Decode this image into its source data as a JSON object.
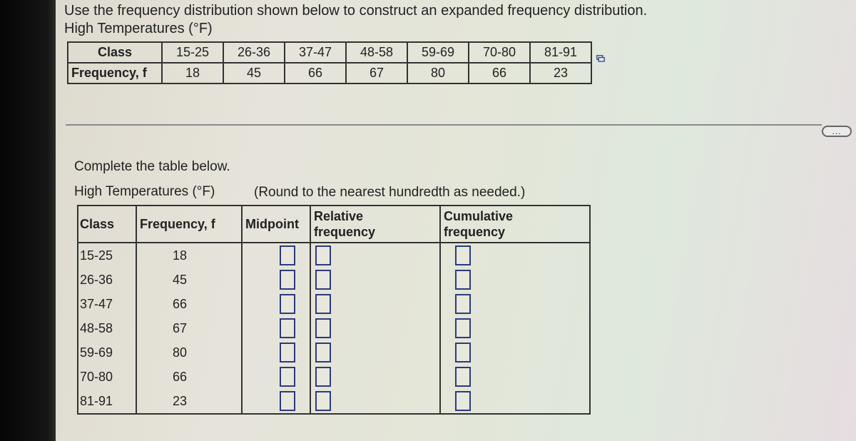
{
  "question": {
    "prompt": "Use the frequency distribution shown below to construct an expanded frequency distribution.",
    "table_title": "High Temperatures (°F)",
    "given_table": {
      "row_labels": [
        "Class",
        "Frequency, f"
      ],
      "classes": [
        "15-25",
        "26-36",
        "37-47",
        "48-58",
        "59-69",
        "70-80",
        "81-91"
      ],
      "frequencies": [
        "18",
        "45",
        "66",
        "67",
        "80",
        "66",
        "23"
      ]
    },
    "copy_icon": "copy-to-clipboard-icon"
  },
  "more_button": {
    "label": "...",
    "icon": "more-options-icon"
  },
  "answer": {
    "instruction": "Complete the table below.",
    "table_title": "High Temperatures (°F)",
    "rounding_note": "(Round to the nearest hundredth as needed.)",
    "headers": {
      "class": "Class",
      "frequency": "Frequency, f",
      "midpoint": "Midpoint",
      "relative_line1": "Relative",
      "relative_line2": "frequency",
      "cumulative_line1": "Cumulative",
      "cumulative_line2": "frequency"
    },
    "rows": [
      {
        "class": "15-25",
        "frequency": "18",
        "midpoint": "",
        "relative": "",
        "cumulative": ""
      },
      {
        "class": "26-36",
        "frequency": "45",
        "midpoint": "",
        "relative": "",
        "cumulative": ""
      },
      {
        "class": "37-47",
        "frequency": "66",
        "midpoint": "",
        "relative": "",
        "cumulative": ""
      },
      {
        "class": "48-58",
        "frequency": "67",
        "midpoint": "",
        "relative": "",
        "cumulative": ""
      },
      {
        "class": "59-69",
        "frequency": "80",
        "midpoint": "",
        "relative": "",
        "cumulative": ""
      },
      {
        "class": "70-80",
        "frequency": "66",
        "midpoint": "",
        "relative": "",
        "cumulative": ""
      },
      {
        "class": "81-91",
        "frequency": "23",
        "midpoint": "",
        "relative": "",
        "cumulative": ""
      }
    ]
  }
}
